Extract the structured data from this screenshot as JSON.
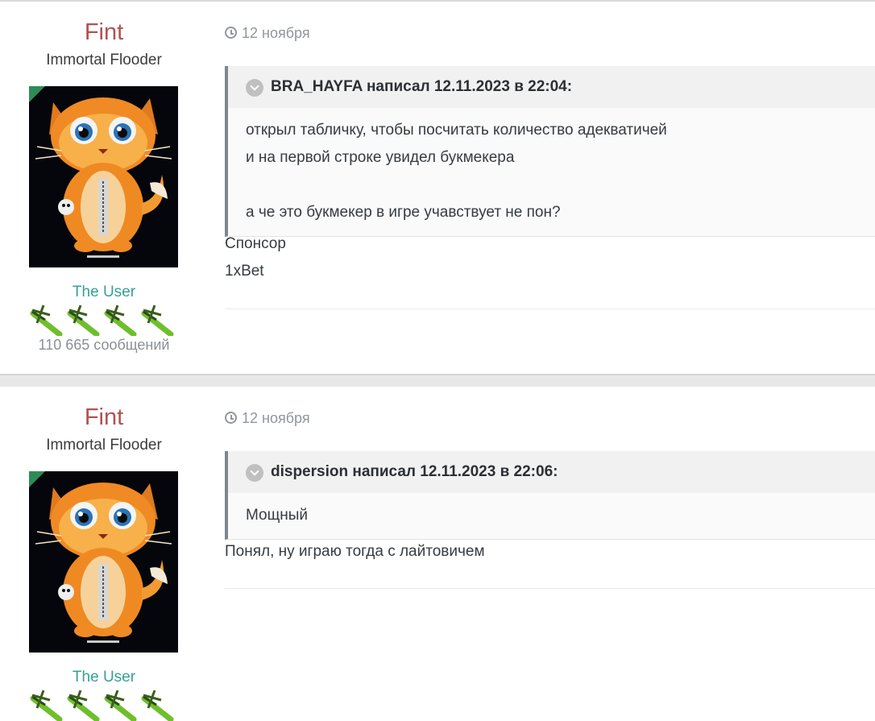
{
  "posts": [
    {
      "author": {
        "name": "Fint",
        "title": "Immortal Flooder",
        "group": "The User",
        "post_count": "110 665 сообщений"
      },
      "date": "12 ноября",
      "quote": {
        "header": "BRA_HAYFA написал 12.11.2023 в 22:04:",
        "lines": [
          "открыл табличку, чтобы посчитать количество адекватичей",
          "и на первой строке увидел букмекера",
          "",
          "а че это букмекер в игре учавствует не пон?"
        ]
      },
      "message_lines": [
        "Спонсор",
        "1xBet"
      ]
    },
    {
      "author": {
        "name": "Fint",
        "title": "Immortal Flooder",
        "group": "The User"
      },
      "date": "12 ноября",
      "quote": {
        "header": "dispersion написал 12.11.2023 в 22:06:",
        "lines": [
          "Мощный"
        ]
      },
      "message_lines": [
        "Понял, ну играю тогда с лайтовичем"
      ]
    }
  ],
  "colors": {
    "author_name": "#b05252",
    "group_name": "#36a194",
    "online_badge": "#2e8b57",
    "quote_border": "#7e878d"
  },
  "icons": [
    "clock-icon",
    "chevron-down-icon",
    "online-badge",
    "rank-icon"
  ]
}
